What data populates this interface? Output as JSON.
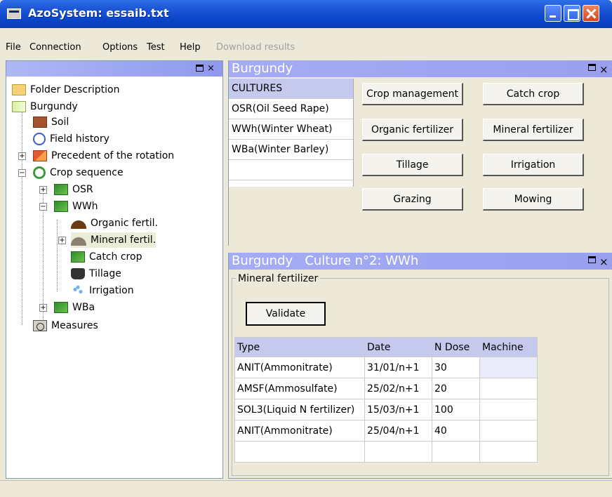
{
  "window": {
    "title": "AzoSystem: essaib.txt"
  },
  "menu": {
    "items": [
      "File",
      "Connection",
      "Options",
      "Test",
      "Help"
    ],
    "disabled_item": "Download results"
  },
  "tree": {
    "close_glyph": "×",
    "nodes": {
      "folder": "Folder Description",
      "site": "Burgundy",
      "soil": "Soil",
      "field_history": "Field history",
      "precedent": "Precedent of the rotation",
      "crop_sequence": "Crop sequence",
      "osr": "OSR",
      "wwh": "WWh",
      "organic": "Organic fertil.",
      "mineral": "Mineral fertil.",
      "catch_crop": "Catch crop",
      "tillage": "Tillage",
      "irrigation": "Irrigation",
      "wba": "WBa",
      "measures": "Measures"
    },
    "expander_plus": "+",
    "expander_minus": "−"
  },
  "top_panel": {
    "title": "Burgundy",
    "close_glyph": "×",
    "cultures_header": "CULTURES",
    "cultures": [
      "OSR(Oil Seed Rape)",
      "WWh(Winter Wheat)",
      "WBa(Winter Barley)",
      ""
    ],
    "buttons": {
      "crop_management": "Crop management",
      "catch_crop": "Catch crop",
      "organic_fertilizer": "Organic fertilizer",
      "mineral_fertilizer": "Mineral fertilizer",
      "tillage": "Tillage",
      "irrigation": "Irrigation",
      "grazing": "Grazing",
      "mowing": "Mowing"
    }
  },
  "bottom_panel": {
    "title": "Burgundy   Culture n°2: WWh",
    "close_glyph": "×",
    "group_label": "Mineral fertilizer",
    "validate": "Validate",
    "columns": [
      "Type",
      "Date",
      "N Dose",
      "Machine"
    ],
    "rows": [
      [
        "ANIT(Ammonitrate)",
        "31/01/n+1",
        "30",
        ""
      ],
      [
        "AMSF(Ammosulfate)",
        "25/02/n+1",
        "20",
        ""
      ],
      [
        "SOL3(Liquid N fertilizer)",
        "15/03/n+1",
        "100",
        ""
      ],
      [
        "ANIT(Ammonitrate)",
        "25/04/n+1",
        "40",
        ""
      ],
      [
        "",
        "",
        "",
        ""
      ]
    ]
  }
}
